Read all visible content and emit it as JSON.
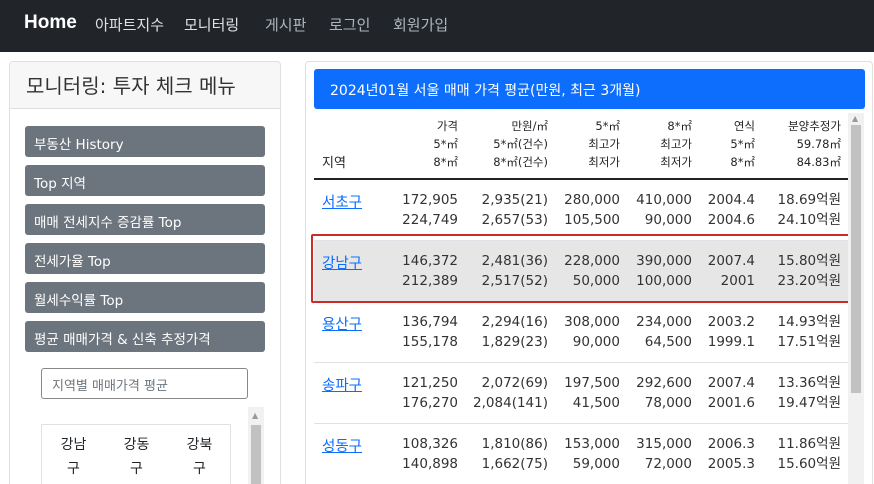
{
  "navbar": {
    "brand": "Home",
    "links": [
      "아파트지수",
      "모니터링",
      "게시판",
      "로그인",
      "회원가입"
    ]
  },
  "sidebar": {
    "title": "모니터링: 투자 체크 메뉴",
    "menu": [
      "부동산 History",
      "Top 지역",
      "매매 전세지수 증감률 Top",
      "전세가율 Top",
      "월세수익률 Top",
      "평균 매매가격 & 신축 추정가격"
    ],
    "search_placeholder": "지역별 매매가격 평균",
    "regions": [
      "강남\n구",
      "강동\n구",
      "강북\n구"
    ]
  },
  "main": {
    "title": "2024년01월 서울 매매 가격 평균(만원, 최근 3개월)",
    "headers": {
      "region": "지역",
      "c1": "가격\n5*㎡\n8*㎡",
      "c2": "만원/㎡\n5*㎡(건수)\n8*㎡(건수)",
      "c3": "5*㎡\n최고가\n최저가",
      "c4": "8*㎡\n최고가\n최저가",
      "c5": "연식\n5*㎡\n8*㎡",
      "c6": "분양추정가\n59.78㎡\n84.83㎡"
    },
    "rows": [
      {
        "name": "서초구",
        "c1": "172,905\n224,749",
        "c2": "2,935(21)\n2,657(53)",
        "c3": "280,000\n105,500",
        "c4": "410,000\n90,000",
        "c5": "2004.4\n2004.6",
        "c6": "18.69억원\n24.10억원"
      },
      {
        "name": "강남구",
        "c1": "146,372\n212,389",
        "c2": "2,481(36)\n2,517(52)",
        "c3": "228,000\n50,000",
        "c4": "390,000\n100,000",
        "c5": "2007.4\n2001",
        "c6": "15.80억원\n23.20억원"
      },
      {
        "name": "용산구",
        "c1": "136,794\n155,178",
        "c2": "2,294(16)\n1,829(23)",
        "c3": "308,000\n90,000",
        "c4": "234,000\n64,500",
        "c5": "2003.2\n1999.1",
        "c6": "14.93억원\n17.51억원"
      },
      {
        "name": "송파구",
        "c1": "121,250\n176,270",
        "c2": "2,072(69)\n2,084(141)",
        "c3": "197,500\n41,500",
        "c4": "292,600\n78,000",
        "c5": "2007.4\n2001.6",
        "c6": "13.36억원\n19.47억원"
      },
      {
        "name": "성동구",
        "c1": "108,326\n140,898",
        "c2": "1,810(86)\n1,662(75)",
        "c3": "153,000\n59,000",
        "c4": "315,000\n72,000",
        "c5": "2006.3\n2005.3",
        "c6": "11.86억원\n15.60억원"
      }
    ]
  },
  "colors": {
    "navbar": "#212529",
    "accent": "#0d6efd",
    "menu_button": "#6c757d",
    "highlight_border": "#cc2b2b"
  }
}
